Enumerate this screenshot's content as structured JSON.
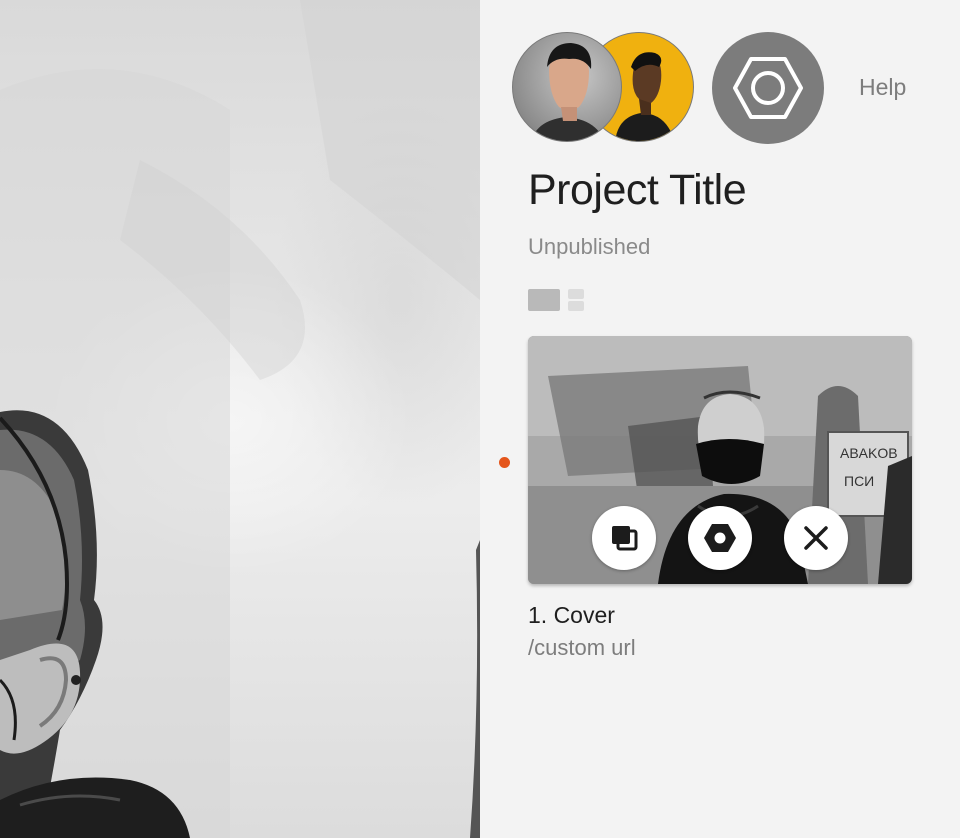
{
  "sidebar": {
    "help_label": "Help",
    "project_title": "Project Title",
    "status": "Unpublished"
  },
  "icons": {
    "settings": "hexagon-nut-icon",
    "duplicate": "duplicate-icon",
    "page_settings": "hexagon-nut-icon",
    "remove": "close-icon"
  },
  "pages": [
    {
      "label": "1. Cover",
      "url": "/custom url",
      "active": true
    }
  ],
  "colors": {
    "avatar_2_bg": "#f0b10f",
    "active_indicator": "#e4551b",
    "settings_button_bg": "#7c7c7c"
  }
}
